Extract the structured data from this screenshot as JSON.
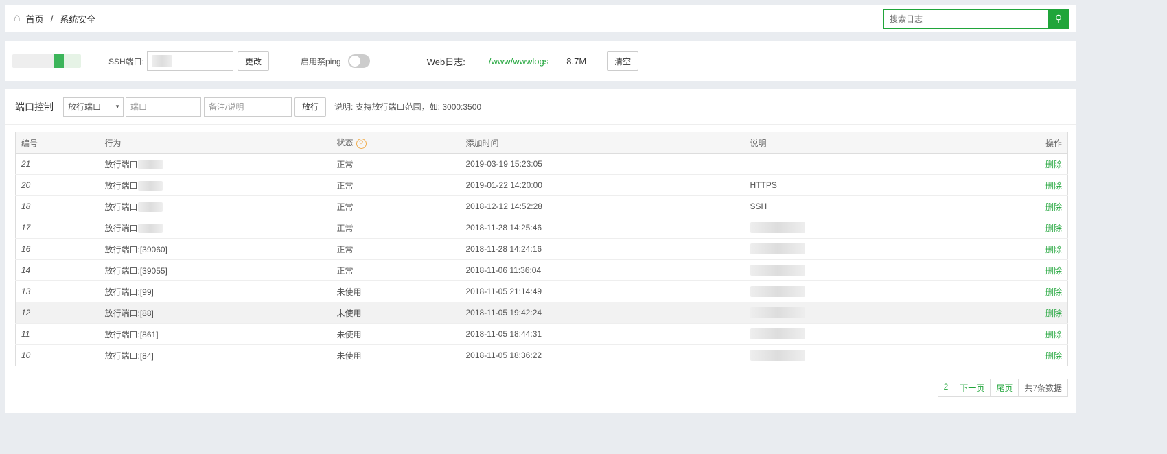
{
  "breadcrumb": {
    "home": "首页",
    "current": "系统安全"
  },
  "search": {
    "placeholder": "搜索日志"
  },
  "info": {
    "ssh_label": "SSH端口:",
    "change": "更改",
    "ping_label": "启用禁ping",
    "ping_enabled": false,
    "weblog_label": "Web日志:",
    "weblog_path": "/www/wwwlogs",
    "weblog_size": "8.7M",
    "clear": "清空"
  },
  "port": {
    "title": "端口控制",
    "select": "放行端口",
    "port_placeholder": "端口",
    "note_placeholder": "备注/说明",
    "submit": "放行",
    "hint": "说明: 支持放行端口范围，如: 3000:3500"
  },
  "table": {
    "headers": [
      "编号",
      "行为",
      "状态",
      "添加时间",
      "说明",
      "操作"
    ],
    "rows": [
      {
        "id": "21",
        "action": "放行端口",
        "status": "正常",
        "time": "2019-03-19 15:23:05",
        "note": "",
        "op": "删除"
      },
      {
        "id": "20",
        "action": "放行端口",
        "status": "正常",
        "time": "2019-01-22 14:20:00",
        "note": "HTTPS",
        "op": "删除"
      },
      {
        "id": "18",
        "action": "放行端口",
        "status": "正常",
        "time": "2018-12-12 14:52:28",
        "note": "SSH",
        "op": "删除"
      },
      {
        "id": "17",
        "action": "放行端口",
        "status": "正常",
        "time": "2018-11-28 14:25:46",
        "note": "",
        "op": "删除"
      },
      {
        "id": "16",
        "action": "放行端口:[39060]",
        "status": "正常",
        "time": "2018-11-28 14:24:16",
        "note": "",
        "op": "删除"
      },
      {
        "id": "14",
        "action": "放行端口:[39055]",
        "status": "正常",
        "time": "2018-11-06 11:36:04",
        "note": "",
        "op": "删除"
      },
      {
        "id": "13",
        "action": "放行端口:[99]",
        "status": "未使用",
        "time": "2018-11-05 21:14:49",
        "note": "",
        "op": "删除"
      },
      {
        "id": "12",
        "action": "放行端口:[88]",
        "status": "未使用",
        "time": "2018-11-05 19:42:24",
        "note": "",
        "op": "删除"
      },
      {
        "id": "11",
        "action": "放行端口:[861]",
        "status": "未使用",
        "time": "2018-11-05 18:44:31",
        "note": "",
        "op": "删除"
      },
      {
        "id": "10",
        "action": "放行端口:[84]",
        "status": "未使用",
        "time": "2018-11-05 18:36:22",
        "note": "",
        "op": "删除"
      }
    ]
  },
  "pager": {
    "page": "2",
    "next": "下一页",
    "last": "尾页",
    "total": "共7条数据"
  },
  "colors": {
    "accent": "#20a53a"
  }
}
